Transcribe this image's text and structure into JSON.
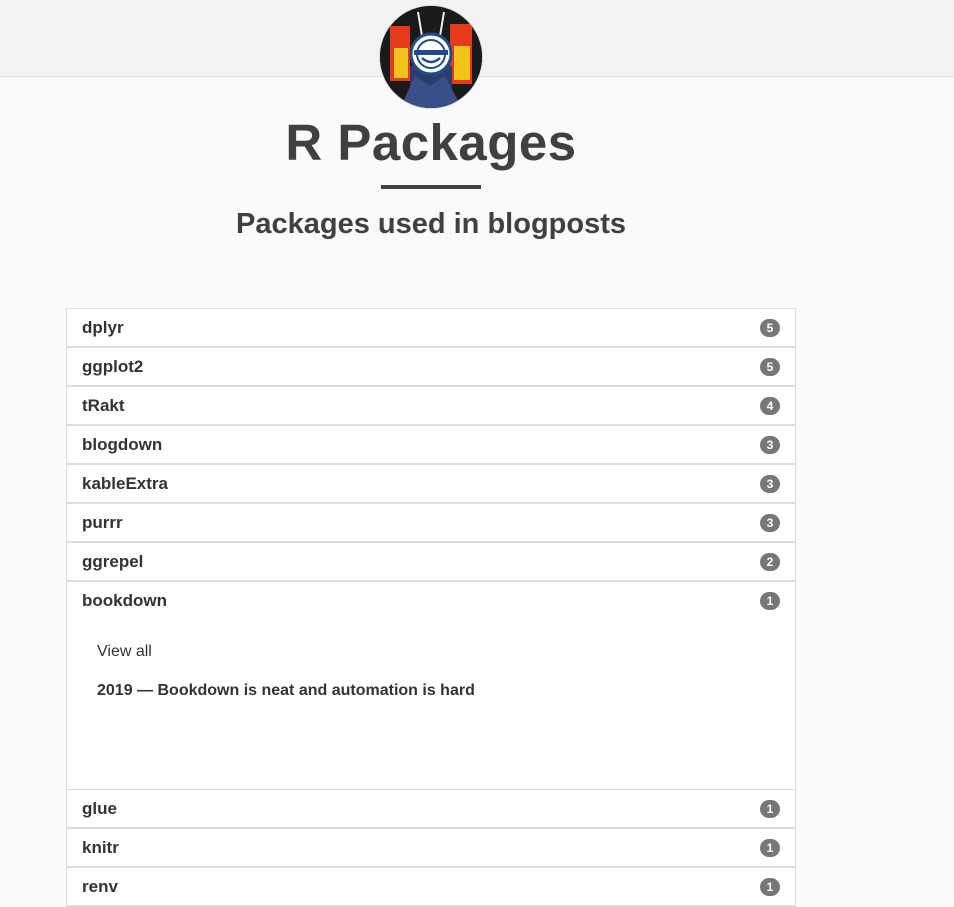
{
  "header": {
    "title": "R Packages",
    "subtitle": "Packages used in blogposts"
  },
  "packages": [
    {
      "name": "dplyr",
      "count": "5"
    },
    {
      "name": "ggplot2",
      "count": "5"
    },
    {
      "name": "tRakt",
      "count": "4"
    },
    {
      "name": "blogdown",
      "count": "3"
    },
    {
      "name": "kableExtra",
      "count": "3"
    },
    {
      "name": "purrr",
      "count": "3"
    },
    {
      "name": "ggrepel",
      "count": "2"
    },
    {
      "name": "bookdown",
      "count": "1",
      "view_all": "View all",
      "post": "2019 — Bookdown is neat and automation is hard"
    },
    {
      "name": "glue",
      "count": "1"
    },
    {
      "name": "knitr",
      "count": "1"
    },
    {
      "name": "renv",
      "count": "1"
    }
  ],
  "colors": {
    "topbar": "#f2f2f2",
    "background": "#fafafa",
    "text": "#404040",
    "badge": "#777777"
  }
}
